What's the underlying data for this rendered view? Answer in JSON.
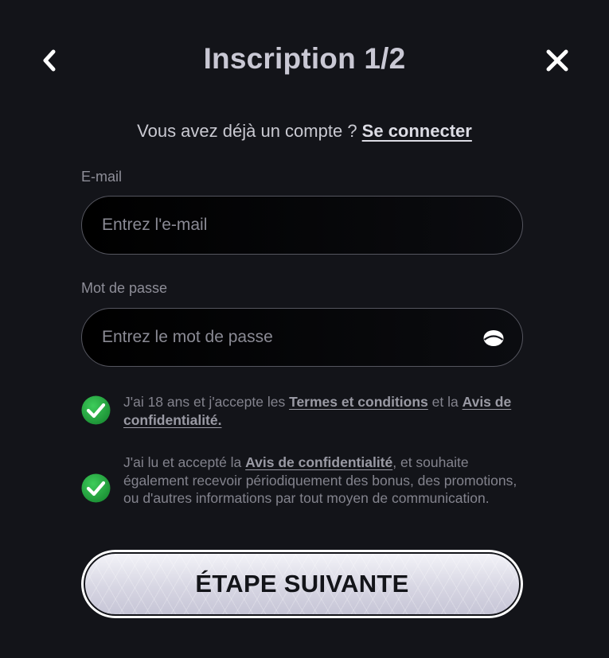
{
  "header": {
    "title": "Inscription 1/2",
    "back_icon": "chevron-left-icon",
    "close_icon": "close-icon"
  },
  "login": {
    "prompt": "Vous avez déjà un compte ? ",
    "link": "Se connecter"
  },
  "email": {
    "label": "E-mail",
    "placeholder": "Entrez l'e-mail",
    "value": ""
  },
  "password": {
    "label": "Mot de passe",
    "placeholder": "Entrez le mot de passe",
    "value": "",
    "toggle_icon": "eye-icon"
  },
  "consents": [
    {
      "checked": true,
      "parts": [
        "J'ai 18 ans et j'accepte les ",
        "Termes et conditions",
        " et la ",
        "Avis de confidentialité."
      ]
    },
    {
      "checked": true,
      "parts": [
        "J'ai lu et accepté la ",
        "Avis de confidentialité",
        ", et souhaite également recevoir périodiquement des bonus, des promotions, ou d'autres informations par tout moyen de communication."
      ]
    }
  ],
  "submit": {
    "label": "ÉTAPE SUIVANTE"
  },
  "colors": {
    "background": "#131419",
    "check_green": "#27a844",
    "button_light": "#dcdbe7"
  }
}
